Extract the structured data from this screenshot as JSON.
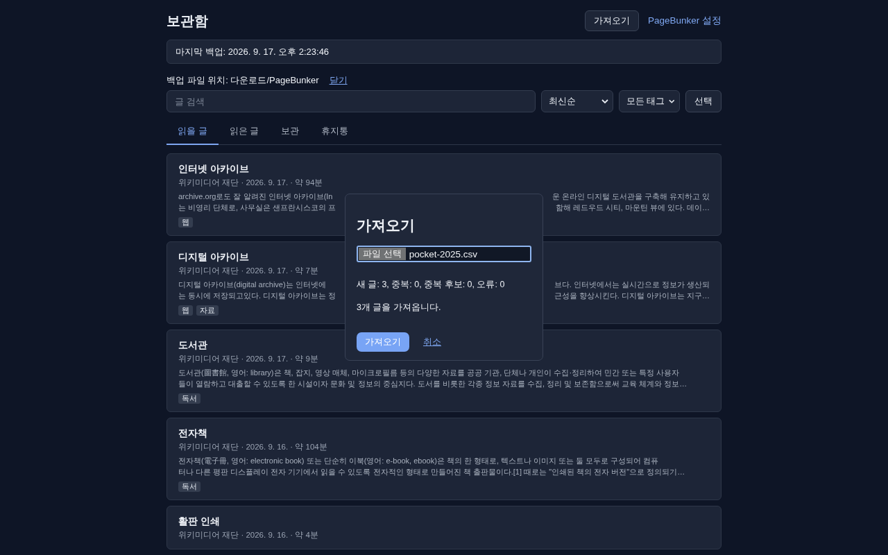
{
  "header": {
    "title": "보관함",
    "import_button": "가져오기",
    "settings_link": "PageBunker 설정"
  },
  "backup_status": "마지막 백업: 2026. 9. 17. 오후 2:23:46",
  "backup_location": {
    "text": "백업 파일 위치: 다운로드/PageBunker",
    "close_link": "닫기"
  },
  "toolbar": {
    "search_placeholder": "글 검색",
    "sort": "최신순",
    "tag_filter": "모든 태그",
    "select_button": "선택"
  },
  "tabs": [
    {
      "label": "읽을 글",
      "selected": true
    },
    {
      "label": "읽은 글",
      "selected": false
    },
    {
      "label": "보관",
      "selected": false
    },
    {
      "label": "휴지통",
      "selected": false
    }
  ],
  "articles": [
    {
      "title": "인터넷 아카이브",
      "meta": "위키미디어 재단 · 2026. 9. 17. · 약 94분",
      "excerpt": [
        [
          "archive.org로도 잘 알려진 인터넷 아카이브(In",
          "운 온라인 디지털 도서관을 구축해 유지하고 있"
        ],
        [
          "는 비영리 단체로, 사무실은 샌프란시스코의 프",
          "함해 레드우드 시티, 마운틴 뷰에 있다. 데이…"
        ]
      ],
      "tags": [
        "웹"
      ]
    },
    {
      "title": "디지털 아카이브",
      "meta": "위키미디어 재단 · 2026. 9. 17. · 약 7분",
      "excerpt": [
        [
          "디지털 아카이브(digital archive)는 인터넷에",
          "브다. 인터넷에서는 실시간으로 정보가 생산되"
        ],
        [
          "는 동시에 저장되고있다. 디지털 아카이브는 정",
          "근성을 향상시킨다. 디지털 아카이브는 지구…"
        ]
      ],
      "tags": [
        "웹",
        "자료"
      ]
    },
    {
      "title": "도서관",
      "meta": "위키미디어 재단 · 2026. 9. 17. · 약 9분",
      "excerpt": [
        [
          "도서관(圖書館, 영어: library)은 책, 잡지, 영상 매체, 마이크로필름 등의 다양한 자료를 공공 기관, 단체나 개인이 수집·정리하여 민간 또는 특정 사용자"
        ],
        [
          "들이 열람하고 대출할 수 있도록 한 시설이자 문화 및 정보의 중심지다. 도서를 비롯한 각종 정보 자료를 수집, 정리 및 보존함으로써 교육 체계와 정보…"
        ]
      ],
      "tags": [
        "독서"
      ]
    },
    {
      "title": "전자책",
      "meta": "위키미디어 재단 · 2026. 9. 16. · 약 104분",
      "excerpt": [
        [
          "전자책(電子冊, 영어: electronic book) 또는 단순히 이북(영어: e-book, ebook)은 책의 한 형태로, 텍스트나 이미지 또는 둘 모두로 구성되어 컴퓨"
        ],
        [
          "터나 다른 평판 디스플레이 전자 기기에서 읽을 수 있도록 전자적인 형태로 만들어진 책 출판물이다.[1] 때로는 \"인쇄된 책의 전자 버전\"으로 정의되기…"
        ]
      ],
      "tags": [
        "독서"
      ]
    },
    {
      "title": "활판 인쇄",
      "meta": "위키미디어 재단 · 2026. 9. 16. · 약 4분"
    }
  ],
  "dialog": {
    "title": "가져오기",
    "file_button": "파일 선택",
    "file_name": "pocket-2025.csv",
    "summary": "새 글: 3, 중복: 0, 중복 후보: 0, 오류: 0",
    "message": "3개 글을 가져옵니다.",
    "confirm_button": "가져오기",
    "cancel_link": "취소"
  }
}
